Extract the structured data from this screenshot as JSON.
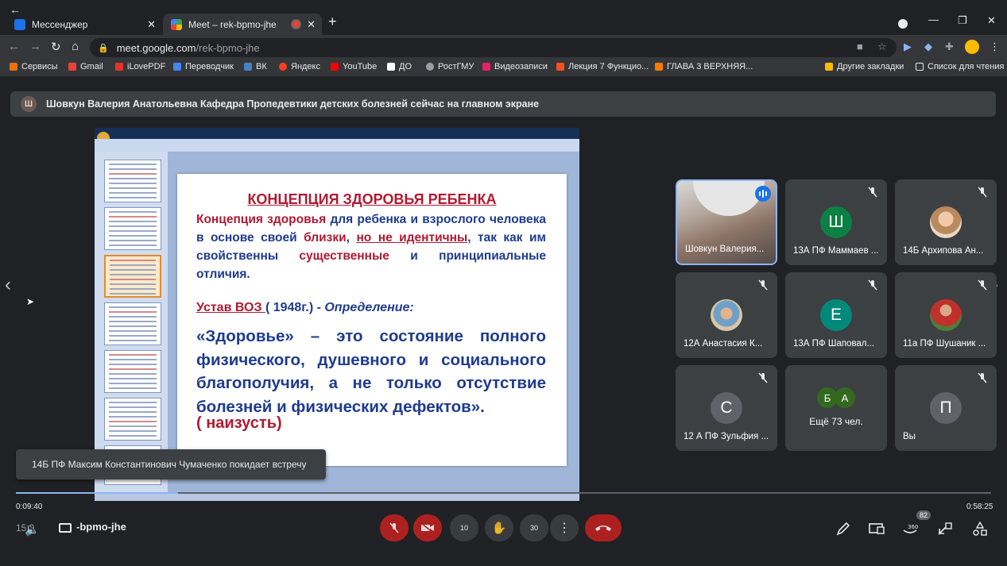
{
  "browser": {
    "tabs": [
      {
        "label": "Мессенджер",
        "favicon_color": "#1a73e8"
      },
      {
        "label": "Meet – rek-bpmo-jhe",
        "favicon_color": "#34a853",
        "recording_dot_color": "#ea4335"
      }
    ],
    "new_tab_label": "+",
    "url_host": "meet.google.com",
    "url_path": "/rek-bpmo-jhe",
    "bookmarks": [
      {
        "label": "Сервисы",
        "color": "#e8710a"
      },
      {
        "label": "Gmail",
        "color": "#ea4335"
      },
      {
        "label": "iLovePDF",
        "color": "#e5322d"
      },
      {
        "label": "Переводчик",
        "color": "#4285f4"
      },
      {
        "label": "ВК",
        "color": "#4680c2"
      },
      {
        "label": "Яндекс",
        "color": "#fc3f1d"
      },
      {
        "label": "YouTube",
        "color": "#ff0000"
      },
      {
        "label": "ДО",
        "color": "#ffffff"
      },
      {
        "label": "РостГМУ",
        "color": "#9aa0a6"
      },
      {
        "label": "Видеозаписи",
        "color": "#e91e63"
      },
      {
        "label": "Лекция 7 Функцио...",
        "color": "#f4511e"
      },
      {
        "label": "ГЛАВА 3 ВЕРХНЯЯ...",
        "color": "#f57c00"
      }
    ],
    "other_bookmarks": "Другие закладки",
    "reading_list": "Список для чтения"
  },
  "meet": {
    "banner": {
      "avatar_letter": "Ш",
      "text": "Шовкун Валерия Анатольевна Кафедра Пропедевтики детских болезней сейчас на главном экране"
    },
    "slide": {
      "title": "КОНЦЕПЦИЯ  ЗДОРОВЬЯ РЕБЕНКА",
      "p1_a": "Концепция  здоровья",
      "p1_b": " для ребенка и взрослого человека в основе  своей ",
      "p1_c": "близки",
      "p1_d": ", ",
      "p1_e": "но не идентичны",
      "p1_f": ", так как им свойственны ",
      "p1_g": "существенные",
      "p1_h": " и принципиальные отличия.",
      "ustav": "Устав ВОЗ ",
      "year": "( 1948г.)",
      "dash": "  - ",
      "definition": "Определение:",
      "quote": "  «Здоровье» – это состояние полного физического, душевного  и социального благополучия, а не только отсутствие болезней и физических дефектов».",
      "memo": "( наизусть)"
    },
    "participants": [
      {
        "name": "Шовкун Валерия...",
        "type": "video"
      },
      {
        "name": "13А ПФ Маммаев ...",
        "letter": "Ш",
        "color": "#0b8043"
      },
      {
        "name": "14Б Архипова Ан...",
        "type": "photo"
      },
      {
        "name": "12А Анастасия К...",
        "type": "photo"
      },
      {
        "name": "13А ПФ Шаповал...",
        "letter": "Е",
        "color": "#00897b"
      },
      {
        "name": "11а ПФ Шушаник ...",
        "type": "photo"
      },
      {
        "name": "12 А ПФ Зульфия ...",
        "letter": "С",
        "color": "#5f6368"
      },
      {
        "name": "Ещё 73 чел.",
        "letters": [
          "Б",
          "А"
        ],
        "color": "#33691e"
      },
      {
        "name": "Вы",
        "letter": "П",
        "color": "#5f6368"
      }
    ],
    "toast": "14Б ПФ Максим Константинович Чумаченко покидает встречу",
    "meeting_code": "-bpmo-jhe",
    "clock": "15:0",
    "badge_count": "82"
  },
  "player": {
    "current": "0:09:40",
    "total": "0:58:25",
    "progress_fraction": 0.166,
    "skip_back": "10",
    "skip_forward": "30"
  }
}
